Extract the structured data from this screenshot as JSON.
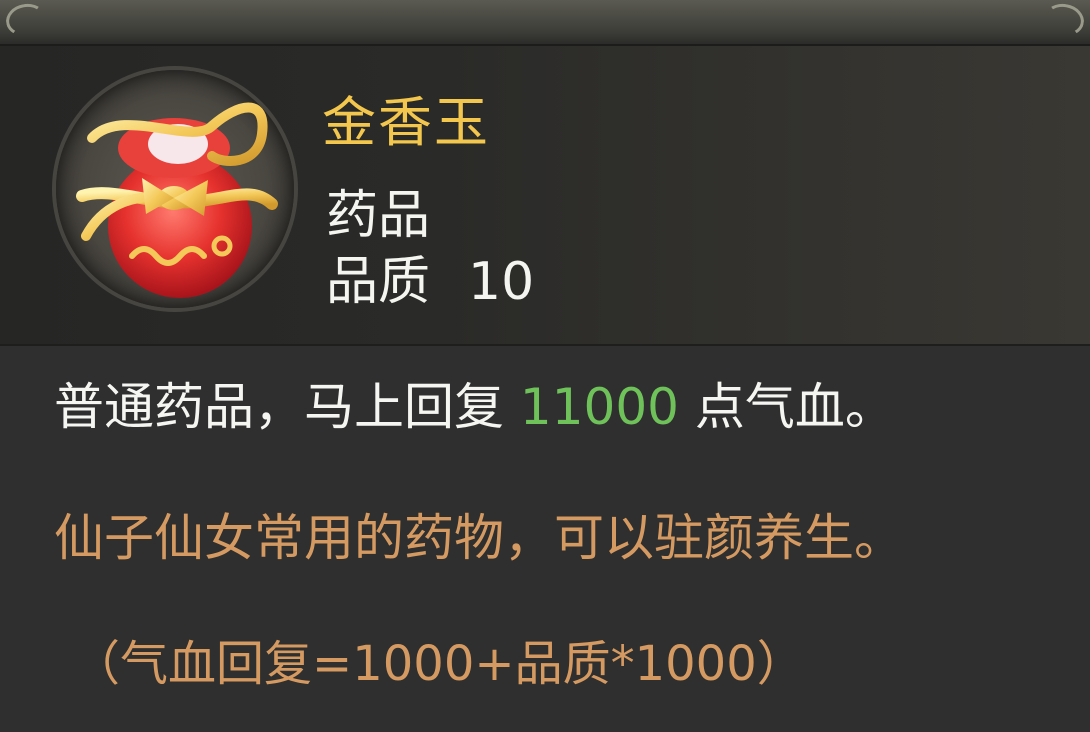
{
  "item": {
    "name": "金香玉",
    "type": "药品",
    "quality_label": "品质",
    "quality_value": "10"
  },
  "description": {
    "before": "普通药品，马上回复 ",
    "amount": "11000",
    "after": " 点气血。"
  },
  "lore": "仙子仙女常用的药物，可以驻颜养生。",
  "formula": "（气血回复=1000+品质*1000）",
  "icons": {
    "item": "gift-pouch-icon"
  },
  "colors": {
    "title": "#f3c74d",
    "amount": "#6fc25a",
    "lore": "#d59a62"
  }
}
